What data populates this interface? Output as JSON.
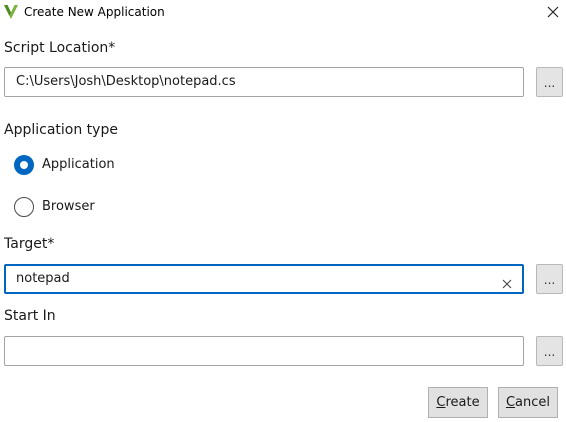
{
  "window": {
    "title": "Create New Application",
    "icon": "v-logo-icon",
    "accent_color": "#0067c0",
    "logo_color": "#7cb342"
  },
  "script_location": {
    "label": "Script Location*",
    "value": "C:\\Users\\Josh\\Desktop\\notepad.cs",
    "browse_label": "..."
  },
  "application_type": {
    "label": "Application type",
    "options": [
      {
        "label": "Application",
        "checked": true
      },
      {
        "label": "Browser",
        "checked": false
      }
    ]
  },
  "target": {
    "label": "Target*",
    "value": "notepad",
    "browse_label": "..."
  },
  "start_in": {
    "label": "Start In",
    "value": "",
    "browse_label": "..."
  },
  "buttons": {
    "create_access": "C",
    "create_rest": "reate",
    "cancel_access": "C",
    "cancel_rest": "ancel"
  }
}
